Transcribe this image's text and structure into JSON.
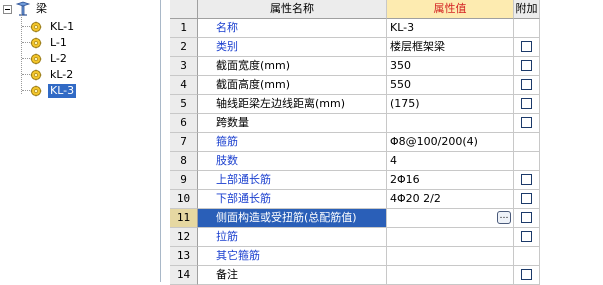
{
  "tree": {
    "root_label": "梁",
    "items": [
      {
        "label": "KL-1",
        "selected": false
      },
      {
        "label": "L-1",
        "selected": false
      },
      {
        "label": "L-2",
        "selected": false
      },
      {
        "label": "kL-2",
        "selected": false
      },
      {
        "label": "KL-3",
        "selected": true
      }
    ]
  },
  "grid": {
    "headers": {
      "name": "属性名称",
      "value": "属性值",
      "extra": "附加"
    },
    "rows": [
      {
        "num": "1",
        "name": "名称",
        "name_color": "blue",
        "value": "KL-3",
        "checkbox": false
      },
      {
        "num": "2",
        "name": "类别",
        "name_color": "blue",
        "value": "楼层框架梁",
        "checkbox": true
      },
      {
        "num": "3",
        "name": "截面宽度(mm)",
        "name_color": "black",
        "value": "350",
        "checkbox": true
      },
      {
        "num": "4",
        "name": "截面高度(mm)",
        "name_color": "black",
        "value": "550",
        "checkbox": true
      },
      {
        "num": "5",
        "name": "轴线距梁左边线距离(mm)",
        "name_color": "black",
        "value": "(175)",
        "checkbox": true
      },
      {
        "num": "6",
        "name": "跨数量",
        "name_color": "black",
        "value": "",
        "checkbox": true
      },
      {
        "num": "7",
        "name": "箍筋",
        "name_color": "blue",
        "value": "Φ8@100/200(4)",
        "checkbox": false
      },
      {
        "num": "8",
        "name": "肢数",
        "name_color": "blue",
        "value": "4",
        "checkbox": false
      },
      {
        "num": "9",
        "name": "上部通长筋",
        "name_color": "blue",
        "value": "2Φ16",
        "checkbox": true
      },
      {
        "num": "10",
        "name": "下部通长筋",
        "name_color": "blue",
        "value": "4Φ20 2/2",
        "checkbox": true
      },
      {
        "num": "11",
        "name": "侧面构造或受扭筋(总配筋值)",
        "name_color": "white",
        "value": "",
        "checkbox": true,
        "selected": true,
        "value_button": "…"
      },
      {
        "num": "12",
        "name": "拉筋",
        "name_color": "blue",
        "value": "",
        "checkbox": true
      },
      {
        "num": "13",
        "name": "其它箍筋",
        "name_color": "blue",
        "value": "",
        "checkbox": false
      },
      {
        "num": "14",
        "name": "备注",
        "name_color": "black",
        "value": "",
        "checkbox": true
      }
    ]
  },
  "colors": {
    "name_blue": "#1a3fcf",
    "selection": "#2a5fb8",
    "value_header_bg": "#fdebb0",
    "value_header_text": "#d42424"
  }
}
